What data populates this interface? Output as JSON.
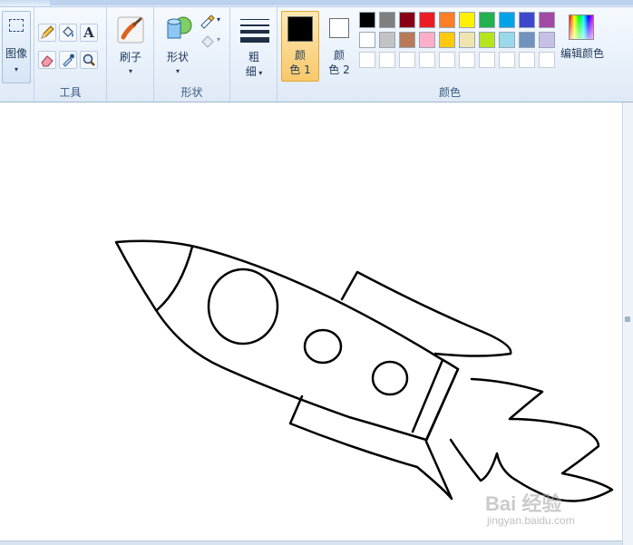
{
  "ribbon": {
    "image_group": {
      "label": "图像",
      "select_icon": "select-rect-icon"
    },
    "tools_group": {
      "label": "工具",
      "icons": [
        "pencil-icon",
        "fill-bucket-icon",
        "text-icon",
        "eraser-icon",
        "color-picker-icon",
        "magnifier-icon"
      ]
    },
    "brushes": {
      "label": "刷子"
    },
    "shapes_group": {
      "label": "形状",
      "shapes_label": "形状"
    },
    "size": {
      "label_line1": "粗",
      "label_line2": "细"
    },
    "color1": {
      "line1": "颜",
      "line2": "色 1",
      "value": "#000000"
    },
    "color2": {
      "line1": "颜",
      "line2": "色 2",
      "value": "#ffffff"
    },
    "colors_group": {
      "label": "颜色"
    },
    "edit_colors": {
      "label": "编辑颜色"
    },
    "palette_row1": [
      "#000000",
      "#7f7f7f",
      "#880015",
      "#ed1c24",
      "#ff7f27",
      "#fff200",
      "#22b14c",
      "#00a2e8",
      "#3f48cc",
      "#a349a4"
    ],
    "palette_row2": [
      "#ffffff",
      "#c3c3c3",
      "#b97a57",
      "#ffaec9",
      "#ffc90e",
      "#efe4b0",
      "#b5e61d",
      "#99d9ea",
      "#7092be",
      "#c8bfe7"
    ],
    "palette_row3": [
      "#ffffff",
      "#ffffff",
      "#ffffff",
      "#ffffff",
      "#ffffff",
      "#ffffff",
      "#ffffff",
      "#ffffff",
      "#ffffff",
      "#ffffff"
    ]
  },
  "watermark": {
    "line1": "Bai 经验",
    "line2": "jingyan.baidu.com"
  },
  "accent": "#fcd37e"
}
